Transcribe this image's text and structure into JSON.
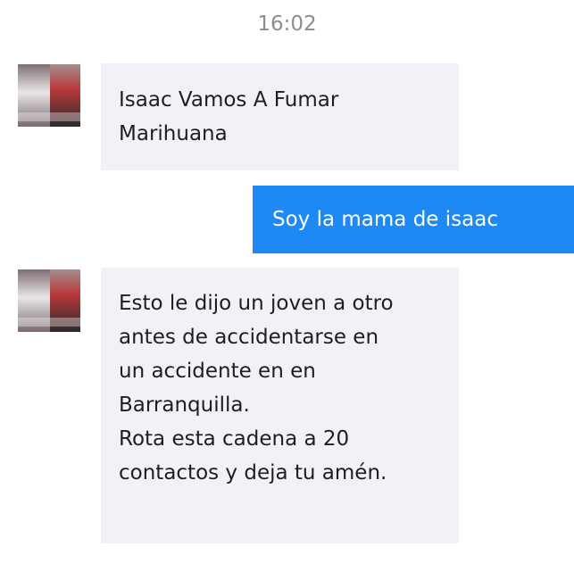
{
  "chat": {
    "timestamp": "16:02",
    "messages": [
      {
        "direction": "incoming",
        "avatar_icon": "contact-avatar",
        "lines": [
          "Isaac Vamos A Fumar",
          "Marihuana"
        ]
      },
      {
        "direction": "outgoing",
        "lines": [
          "Soy la mama de isaac"
        ]
      },
      {
        "direction": "incoming",
        "avatar_icon": "contact-avatar",
        "lines": [
          "Esto le dijo un joven a otro",
          "antes de accidentarse en",
          "un accidente en en",
          "Barranquilla.",
          "Rota esta cadena a 20",
          "contactos y deja tu amén."
        ]
      }
    ]
  },
  "colors": {
    "incoming_bubble": "#f1f2f7",
    "outgoing_bubble": "#1e88f5",
    "timestamp_text": "#8a8d91"
  }
}
